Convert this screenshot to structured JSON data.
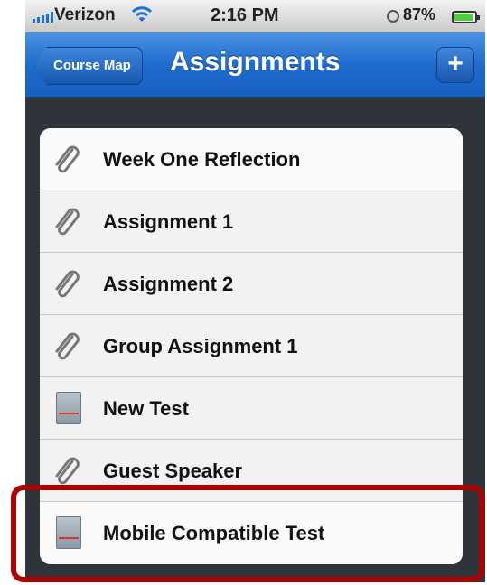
{
  "status_bar": {
    "carrier": "Verizon",
    "time": "2:16 PM",
    "battery_percent": "87%",
    "signal_icon": "signal-bars-icon",
    "wifi_icon": "wifi-icon"
  },
  "nav": {
    "back_label": "Course Map",
    "title": "Assignments",
    "add_label": "+"
  },
  "items": [
    {
      "label": "Week One Reflection",
      "icon": "paperclip-icon"
    },
    {
      "label": "Assignment 1",
      "icon": "paperclip-icon"
    },
    {
      "label": "Assignment 2",
      "icon": "paperclip-icon"
    },
    {
      "label": "Group Assignment 1",
      "icon": "paperclip-icon"
    },
    {
      "label": "New Test",
      "icon": "test-document-icon"
    },
    {
      "label": "Guest Speaker",
      "icon": "paperclip-icon"
    },
    {
      "label": "Mobile Compatible Test",
      "icon": "test-document-icon"
    }
  ],
  "colors": {
    "nav_blue": "#1f6ccd",
    "highlight_red": "#b00000"
  }
}
